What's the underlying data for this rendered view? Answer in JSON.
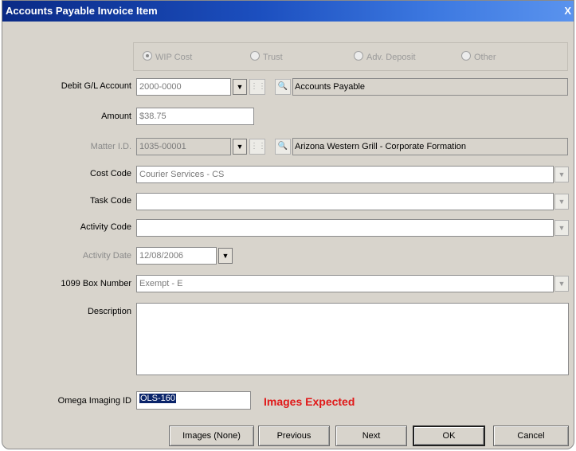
{
  "window": {
    "title": "Accounts Payable Invoice Item",
    "close_glyph": "X"
  },
  "radios": [
    {
      "label": "WIP Cost",
      "selected": true
    },
    {
      "label": "Trust",
      "selected": false
    },
    {
      "label": "Adv. Deposit",
      "selected": false
    },
    {
      "label": "Other",
      "selected": false
    }
  ],
  "debit_gl": {
    "label": "Debit G/L Account",
    "value": "2000-0000",
    "description": "Accounts Payable"
  },
  "amount": {
    "label": "Amount",
    "value": "$38.75"
  },
  "matter": {
    "label": "Matter I.D.",
    "value": "1035-00001",
    "description": "Arizona Western Grill - Corporate Formation"
  },
  "cost_code": {
    "label": "Cost Code",
    "value": "Courier Services - CS"
  },
  "task_code": {
    "label": "Task Code",
    "value": ""
  },
  "activity_code": {
    "label": "Activity Code",
    "value": ""
  },
  "activity_date": {
    "label": "Activity Date",
    "value": "12/08/2006"
  },
  "box_1099": {
    "label": "1099 Box Number",
    "value": "Exempt - E"
  },
  "description": {
    "label": "Description",
    "value": ""
  },
  "imaging": {
    "label": "Omega Imaging ID",
    "value": "OLS-160",
    "status": "Images Expected",
    "status_color": "#e01818"
  },
  "buttons": {
    "images": "Images (None)",
    "previous": "Previous",
    "next": "Next",
    "ok": "OK",
    "cancel": "Cancel"
  },
  "icons": {
    "dropdown": "chevron-down-icon",
    "list": "list-icon",
    "lookup": "lookup-icon"
  }
}
